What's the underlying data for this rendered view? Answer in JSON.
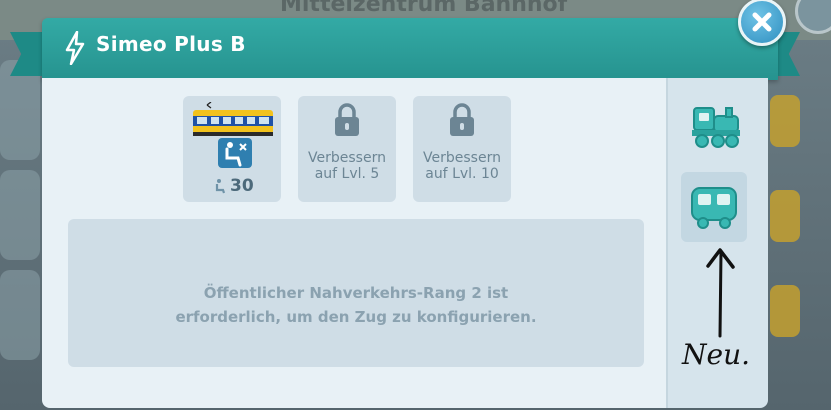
{
  "background": {
    "station_title": "Mittelzentrum Bahnhof"
  },
  "dialog": {
    "title": "Simeo Plus B",
    "close_icon": "close-icon"
  },
  "slots": [
    {
      "type": "wagon",
      "capacity": "30",
      "icon": "seat-icon"
    },
    {
      "type": "locked",
      "line1": "Verbessern",
      "line2": "auf Lvl. 5",
      "icon": "lock-icon"
    },
    {
      "type": "locked",
      "line1": "Verbessern",
      "line2": "auf Lvl. 10",
      "icon": "lock-icon"
    }
  ],
  "info": {
    "line1": "Öffentlicher Nahverkehrs-Rang 2 ist",
    "line2": "erforderlich, um den Zug zu konfigurieren."
  },
  "side_tabs": [
    {
      "name": "locomotive-tab",
      "icon": "locomotive-icon"
    },
    {
      "name": "wagon-tab",
      "icon": "wagon-icon",
      "selected": true
    }
  ],
  "annotation": {
    "text": "Neu."
  },
  "colors": {
    "header": "#2a9a96",
    "accent": "#37b8b3",
    "panel": "#e8f1f6",
    "slot": "#cfdde6"
  }
}
